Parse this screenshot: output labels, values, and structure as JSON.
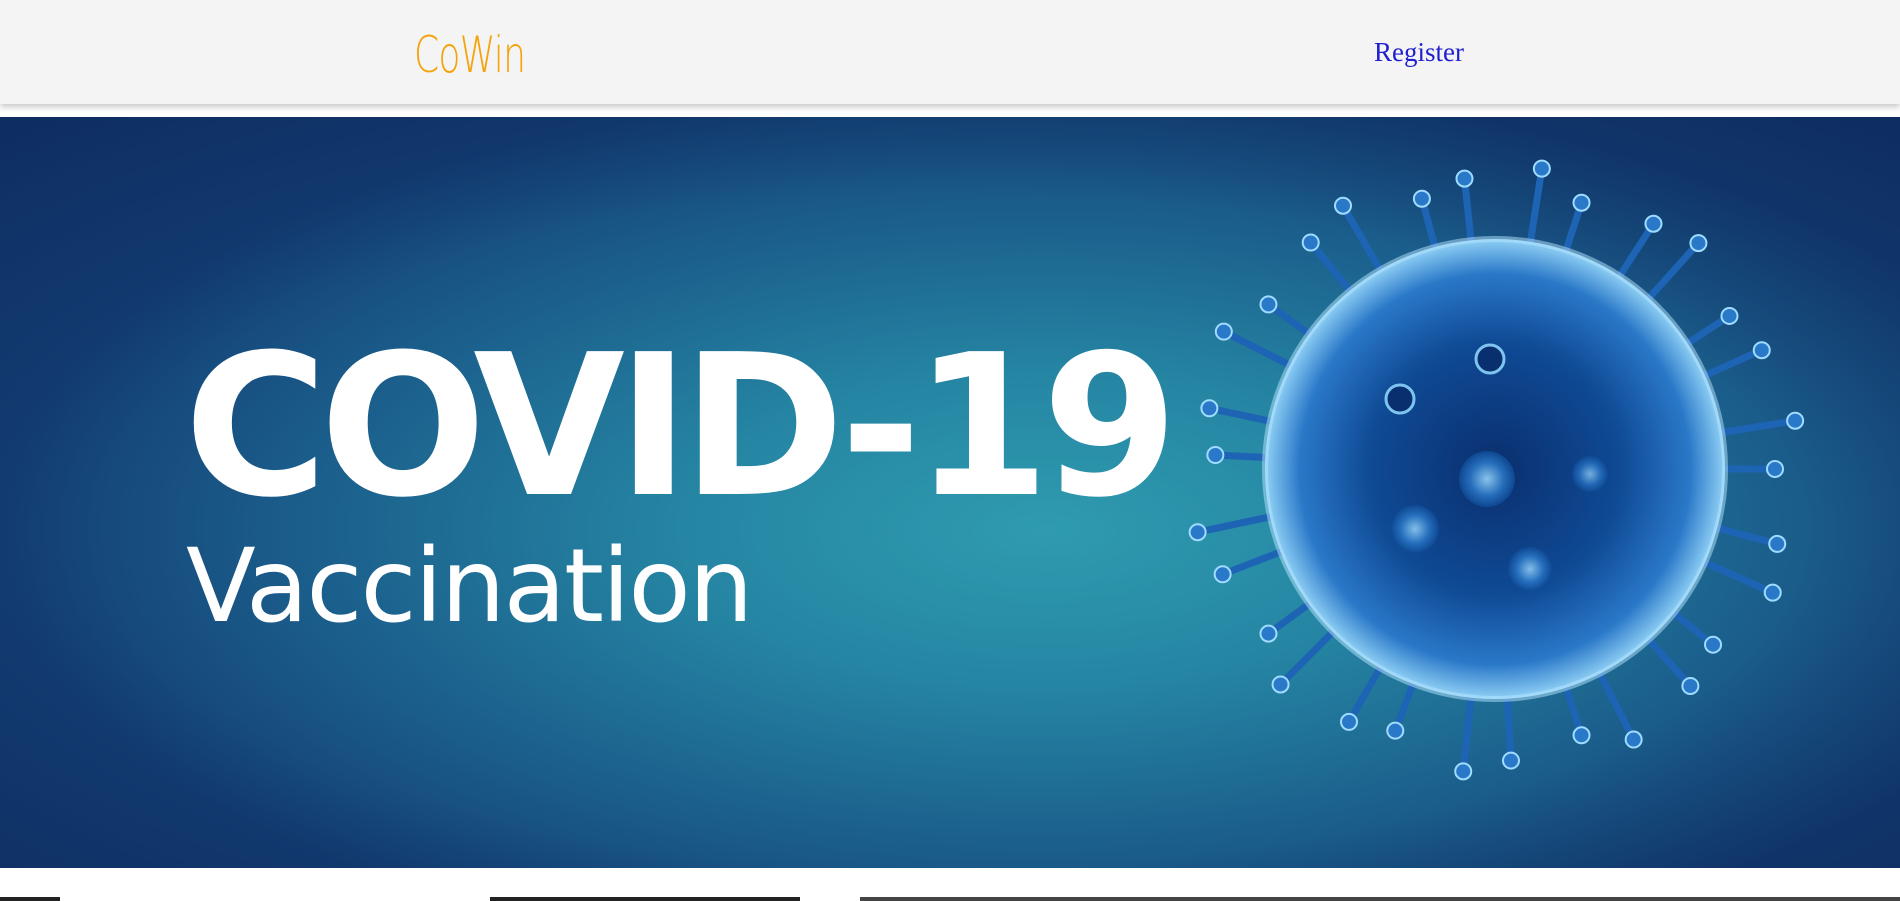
{
  "navbar": {
    "brand": "CoWin",
    "register_link": "Register",
    "brand_color": "#f5a30a",
    "link_color": "#1f1fd0"
  },
  "hero": {
    "title": "COVID-19",
    "subtitle": "Vaccination",
    "virus_icon": "virus-icon",
    "background_color": "#2585a3"
  }
}
